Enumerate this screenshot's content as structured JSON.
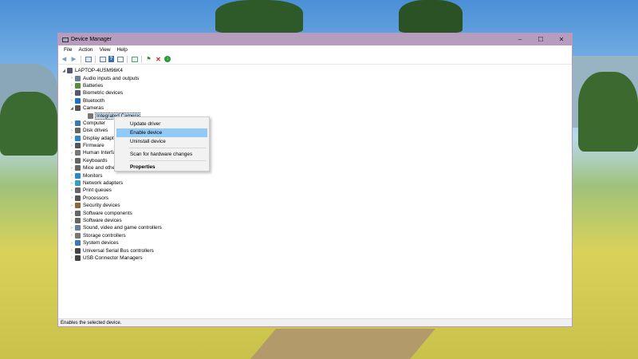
{
  "window": {
    "title": "Device Manager"
  },
  "menu": [
    "File",
    "Action",
    "View",
    "Help"
  ],
  "tree": {
    "root": "LAPTOP-4USM96K4",
    "categories": [
      {
        "label": "Audio inputs and outputs",
        "icon": "speaker-icon",
        "color": "#6a7f99"
      },
      {
        "label": "Batteries",
        "icon": "battery-icon",
        "color": "#5a8f3a"
      },
      {
        "label": "Biometric devices",
        "icon": "fingerprint-icon",
        "color": "#557"
      },
      {
        "label": "Bluetooth",
        "icon": "bluetooth-icon",
        "color": "#1f6fd1"
      },
      {
        "label": "Cameras",
        "icon": "camera-icon",
        "color": "#555"
      },
      {
        "label": "Integrated Camera",
        "icon": "webcam-icon",
        "color": "#777"
      },
      {
        "label": "Computer",
        "icon": "computer-icon",
        "color": "#3a78b8"
      },
      {
        "label": "Disk drives",
        "icon": "disk-icon",
        "color": "#666"
      },
      {
        "label": "Display adapt",
        "icon": "display-icon",
        "color": "#2a87c9"
      },
      {
        "label": "Firmware",
        "icon": "chip-icon",
        "color": "#555"
      },
      {
        "label": "Human Interfa",
        "icon": "hid-icon",
        "color": "#777"
      },
      {
        "label": "Keyboards",
        "icon": "keyboard-icon",
        "color": "#666"
      },
      {
        "label": "Mice and othe",
        "icon": "mouse-icon",
        "color": "#666"
      },
      {
        "label": "Monitors",
        "icon": "monitor-icon",
        "color": "#2a87c9"
      },
      {
        "label": "Network adapters",
        "icon": "network-icon",
        "color": "#3a9ac9"
      },
      {
        "label": "Print queues",
        "icon": "printer-icon",
        "color": "#666"
      },
      {
        "label": "Processors",
        "icon": "cpu-icon",
        "color": "#555"
      },
      {
        "label": "Security devices",
        "icon": "security-icon",
        "color": "#8a6a3a"
      },
      {
        "label": "Software components",
        "icon": "component-icon",
        "color": "#666"
      },
      {
        "label": "Software devices",
        "icon": "software-device-icon",
        "color": "#666"
      },
      {
        "label": "Sound, video and game controllers",
        "icon": "sound-icon",
        "color": "#6a7f99"
      },
      {
        "label": "Storage controllers",
        "icon": "storage-icon",
        "color": "#777"
      },
      {
        "label": "System devices",
        "icon": "system-icon",
        "color": "#3a78b8"
      },
      {
        "label": "Universal Serial Bus controllers",
        "icon": "usb-icon",
        "color": "#444"
      },
      {
        "label": "USB Connector Managers",
        "icon": "usb-connector-icon",
        "color": "#444"
      }
    ]
  },
  "context_menu": {
    "items": [
      "Update driver",
      "Enable device",
      "Uninstall device",
      "Scan for hardware changes",
      "Properties"
    ],
    "highlighted": "Enable device"
  },
  "status": "Enables the selected device."
}
